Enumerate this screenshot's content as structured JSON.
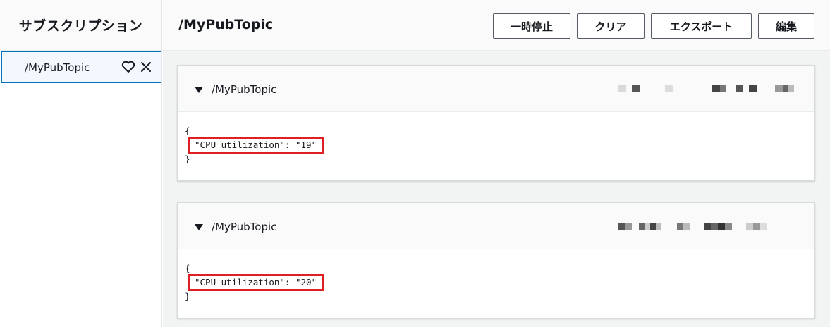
{
  "sidebar": {
    "title": "サブスクリプション",
    "subscriptions": [
      {
        "topic": "/MyPubTopic"
      }
    ]
  },
  "main": {
    "title": "/MyPubTopic",
    "toolbar": {
      "pause": "一時停止",
      "clear": "クリア",
      "export": "エクスポート",
      "edit": "編集"
    }
  },
  "messages": [
    {
      "topic": "/MyPubTopic",
      "open_brace": "{",
      "payload_line": "\"CPU utilization\": \"19\"",
      "close_brace": "}"
    },
    {
      "topic": "/MyPubTopic",
      "open_brace": "{",
      "payload_line": "\"CPU utilization\": \"20\"",
      "close_brace": "}"
    }
  ],
  "colors": {
    "highlight": "#e01f25",
    "selected_border": "#0073bb"
  }
}
